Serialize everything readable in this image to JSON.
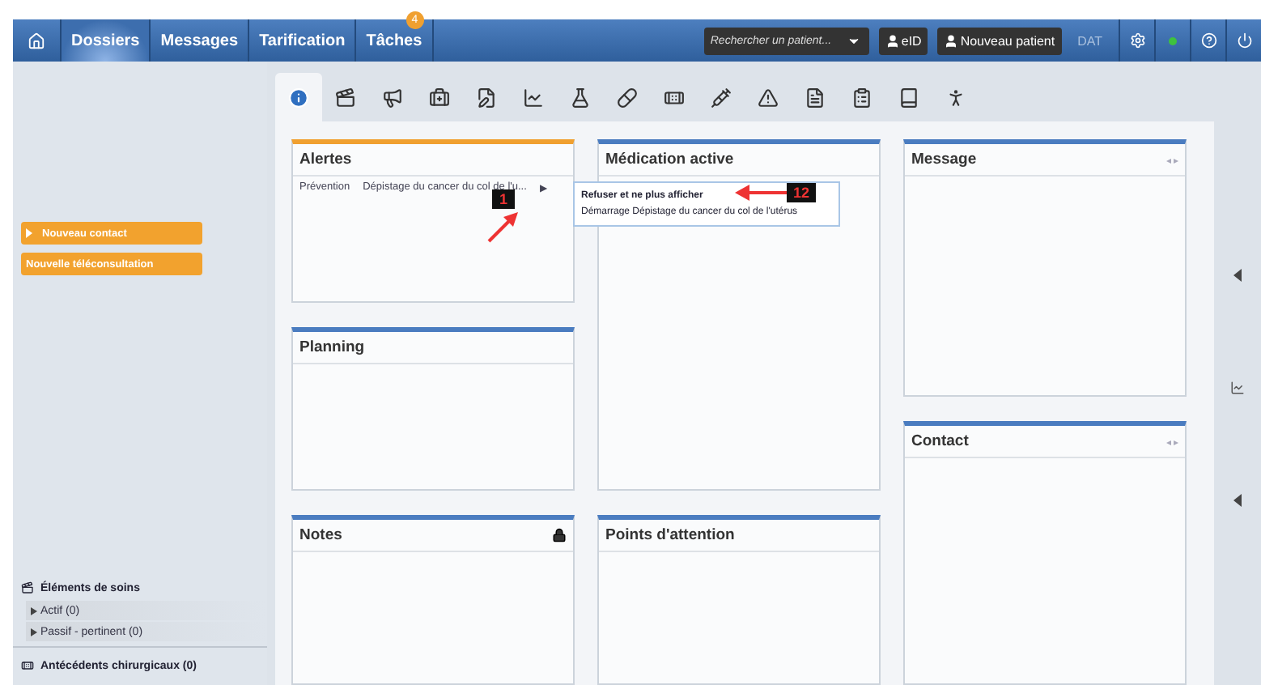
{
  "nav": {
    "tabs": [
      {
        "label": "Dossiers",
        "selected": true
      },
      {
        "label": "Messages",
        "selected": false
      },
      {
        "label": "Tarification",
        "selected": false
      },
      {
        "label": "Tâches",
        "selected": false,
        "badge": "4"
      }
    ],
    "search": {
      "placeholder": "Rechercher un patient..."
    },
    "buttons": [
      "eID",
      "Nouveau patient"
    ],
    "dat": {
      "label": "DAT",
      "disabled": true
    },
    "status_dot": {
      "color": "#3ec23e"
    }
  },
  "sidebar": {
    "actions": [
      {
        "label": "Nouveau contact",
        "kind": "caret"
      },
      {
        "label": "Nouvelle téléconsultation",
        "kind": "plain"
      }
    ],
    "sections": [
      {
        "title": "Éléments de soins",
        "children": [
          {
            "label": "Actif (0)",
            "expanded": false
          },
          {
            "label": "Passif - pertinent (0)",
            "expanded": false
          }
        ]
      },
      {
        "title": "Antécédents chirurgicaux (0)"
      }
    ]
  },
  "toolbar": [
    {
      "kind": "info",
      "selected": true
    },
    {
      "kind": "clapper",
      "selected": false
    },
    {
      "kind": "megaphone",
      "selected": false
    },
    {
      "kind": "medkit",
      "selected": false
    },
    {
      "kind": "edit",
      "selected": false
    },
    {
      "kind": "chart",
      "selected": false
    },
    {
      "kind": "flask",
      "selected": false
    },
    {
      "kind": "pill",
      "selected": false
    },
    {
      "kind": "bandage",
      "selected": false
    },
    {
      "kind": "syringe",
      "selected": false
    },
    {
      "kind": "warning",
      "selected": false
    },
    {
      "kind": "doc",
      "selected": false
    },
    {
      "kind": "clipboard",
      "selected": false
    },
    {
      "kind": "book",
      "selected": false
    },
    {
      "kind": "person",
      "selected": false
    }
  ],
  "columns": [
    [
      {
        "title": "Alertes",
        "color": "#f0a030",
        "rows": [
          {
            "category": "Prévention",
            "text": "Dépistage du cancer du col de l'u...",
            "arrow": "▶"
          }
        ]
      },
      {
        "title": "Planning",
        "color": "#4a7cc0"
      },
      {
        "title": "Notes",
        "color": "#4a7cc0",
        "locked": true
      }
    ],
    [
      {
        "title": "Médication active",
        "color": "#4a7cc0"
      },
      {
        "title": "Points d'attention",
        "color": "#4a7cc0"
      }
    ],
    [
      {
        "title": "Message",
        "color": "#4a7cc0",
        "pager": "◂ ▸"
      },
      {
        "title": "Contact",
        "color": "#4a7cc0",
        "pager": "◂ ▸"
      }
    ]
  ],
  "popup": {
    "items": [
      {
        "label": "Refuser et ne plus afficher",
        "kind": "bold"
      },
      {
        "label": "Démarrage Dépistage du cancer du col de l'utérus",
        "kind": "plain"
      }
    ]
  },
  "annotations": [
    {
      "label": "1",
      "kind": "up"
    },
    {
      "label": "12",
      "kind": "left"
    }
  ]
}
